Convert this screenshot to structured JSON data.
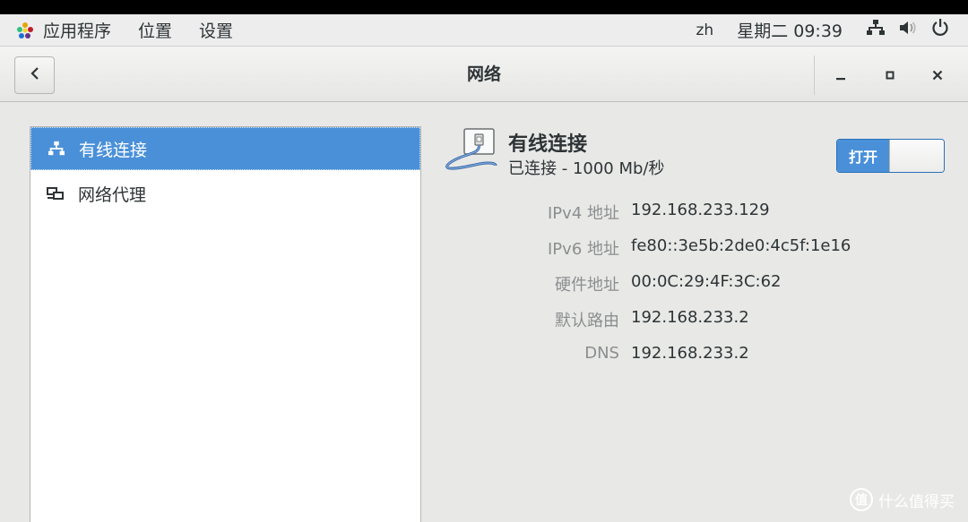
{
  "panel": {
    "apps_label": "应用程序",
    "places_label": "位置",
    "settings_label": "设置",
    "lang": "zh",
    "clock": "星期二 09:39"
  },
  "window": {
    "title": "网络"
  },
  "sidebar": {
    "items": [
      {
        "label": "有线连接",
        "icon": "network-wired-icon",
        "selected": true
      },
      {
        "label": "网络代理",
        "icon": "network-proxy-icon",
        "selected": false
      }
    ]
  },
  "connection": {
    "title": "有线连接",
    "status": "已连接 - 1000 Mb/秒",
    "switch_label": "打开",
    "switch_on": true,
    "details": [
      {
        "key": "IPv4 地址",
        "value": "192.168.233.129"
      },
      {
        "key": "IPv6 地址",
        "value": "fe80::3e5b:2de0:4c5f:1e16"
      },
      {
        "key": "硬件地址",
        "value": "00:0C:29:4F:3C:62"
      },
      {
        "key": "默认路由",
        "value": "192.168.233.2"
      },
      {
        "key": "DNS",
        "value": "192.168.233.2"
      }
    ]
  },
  "watermark": {
    "badge": "值",
    "text": "什么值得买"
  },
  "colors": {
    "accent": "#4a90d9",
    "panel_bg": "#ededed",
    "window_bg": "#e8e8e7"
  }
}
